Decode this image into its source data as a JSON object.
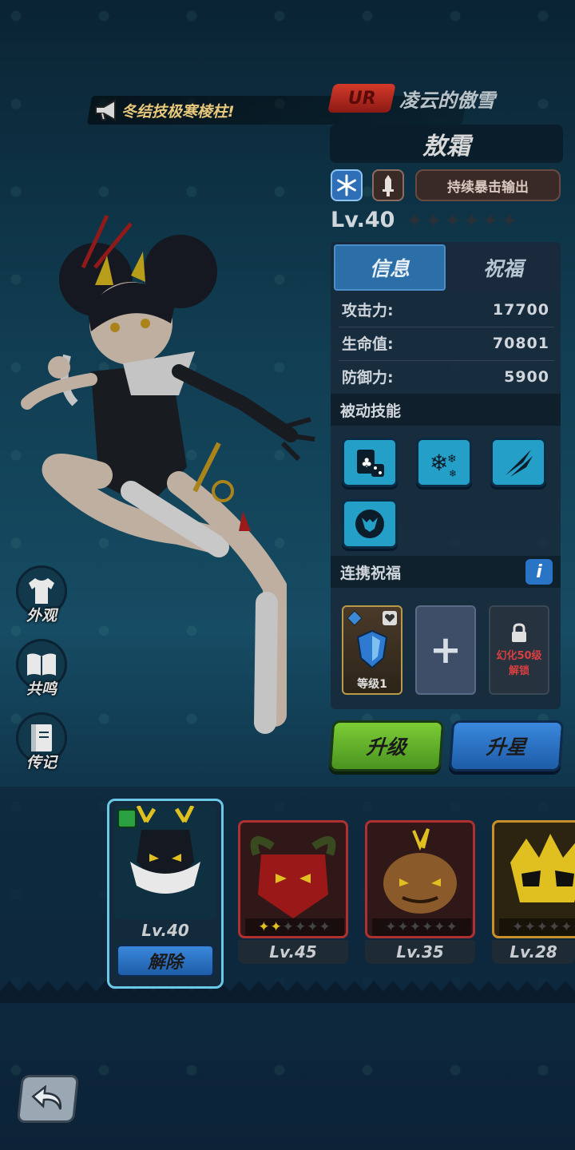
{
  "announcement": {
    "text": "冬结技极寒棱柱!",
    "icon": "megaphone-icon"
  },
  "hero": {
    "rarity": "UR",
    "subtitle": "凌云的傲雪",
    "name": "敖霜",
    "element_icon": "snowflake-icon",
    "weapon_icon": "sword-icon",
    "role": "持续暴击输出",
    "level": "Lv.40",
    "stars_filled": 0,
    "stars_total": 6
  },
  "tabs": {
    "info": "信息",
    "bless": "祝福"
  },
  "stats": [
    {
      "label": "攻击力:",
      "value": "17700"
    },
    {
      "label": "生命值:",
      "value": "70801"
    },
    {
      "label": "防御力:",
      "value": "5900"
    }
  ],
  "passive": {
    "title": "被动技能",
    "skills": [
      "card-dice-icon",
      "snowflakes-icon",
      "claw-slash-icon",
      "dragon-emblem-icon"
    ]
  },
  "link_bless": {
    "title": "连携祝福",
    "info_glyph": "i",
    "slot1_label": "等级1",
    "slot2_glyph": "+",
    "slot3_line1": "幻化50级",
    "slot3_line2": "解锁"
  },
  "buttons": {
    "upgrade": "升级",
    "upstar": "升星",
    "remove": "解除"
  },
  "side": [
    {
      "label": "外观",
      "icon": "shirt-icon"
    },
    {
      "label": "共鸣",
      "icon": "book-icon"
    },
    {
      "label": "传记",
      "icon": "journal-icon"
    }
  ],
  "pets": [
    {
      "level": "Lv.40",
      "stars_filled": 0,
      "selected": true,
      "frame": "#3a6a8a"
    },
    {
      "level": "Lv.45",
      "stars_filled": 2,
      "selected": false,
      "frame": "#b03030"
    },
    {
      "level": "Lv.35",
      "stars_filled": 0,
      "selected": false,
      "frame": "#b03030"
    },
    {
      "level": "Lv.28",
      "stars_filled": 0,
      "selected": false,
      "frame": "#c8902a"
    }
  ],
  "colors": {
    "upgrade": "#5aaa2a",
    "upstar": "#2a74c6",
    "rarity": "#c03020"
  }
}
